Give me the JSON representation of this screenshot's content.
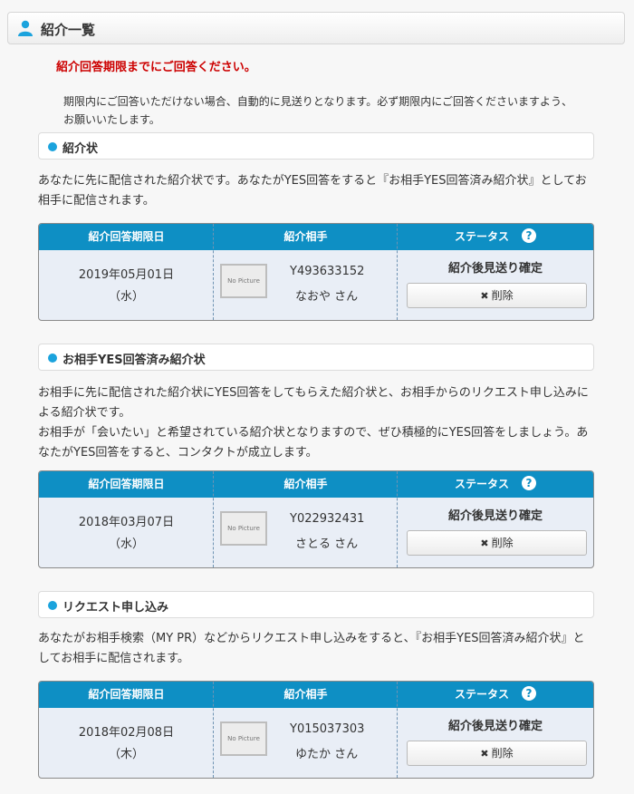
{
  "header": {
    "title": "紹介一覧",
    "icon": "user-icon"
  },
  "alert": "紹介回答期限までにご回答ください。",
  "notice": "期限内にご回答いただけない場合、自動的に見送りとなります。必ず期限内にご回答くださいますよう、お願いいたします。",
  "table_headers": {
    "date": "紹介回答期限日",
    "partner": "紹介相手",
    "status": "ステータス",
    "help_icon": "?"
  },
  "no_picture": "No Picture",
  "delete_label": "削除",
  "sections": [
    {
      "title": "紹介状",
      "desc": "あなたに先に配信された紹介状です。あなたがYES回答をすると『お相手YES回答済み紹介状』としてお相手に配信されます。",
      "row": {
        "date": "2019年05月01日",
        "weekday": "（水）",
        "partner_id": "Y493633152",
        "partner_name": "なおや さん",
        "status": "紹介後見送り確定"
      }
    },
    {
      "title": "お相手YES回答済み紹介状",
      "desc": "お相手に先に配信された紹介状にYES回答をしてもらえた紹介状と、お相手からのリクエスト申し込みによる紹介状です。\nお相手が「会いたい」と希望されている紹介状となりますので、ぜひ積極的にYES回答をしましょう。あなたがYES回答をすると、コンタクトが成立します。",
      "row": {
        "date": "2018年03月07日",
        "weekday": "（水）",
        "partner_id": "Y022932431",
        "partner_name": "さとる さん",
        "status": "紹介後見送り確定"
      }
    },
    {
      "title": "リクエスト申し込み",
      "desc": "あなたがお相手検索（MY PR）などからリクエスト申し込みをすると、『お相手YES回答済み紹介状』としてお相手に配信されます。",
      "row": {
        "date": "2018年02月08日",
        "weekday": "（木）",
        "partner_id": "Y015037303",
        "partner_name": "ゆたか さん",
        "status": "紹介後見送り確定"
      }
    }
  ]
}
